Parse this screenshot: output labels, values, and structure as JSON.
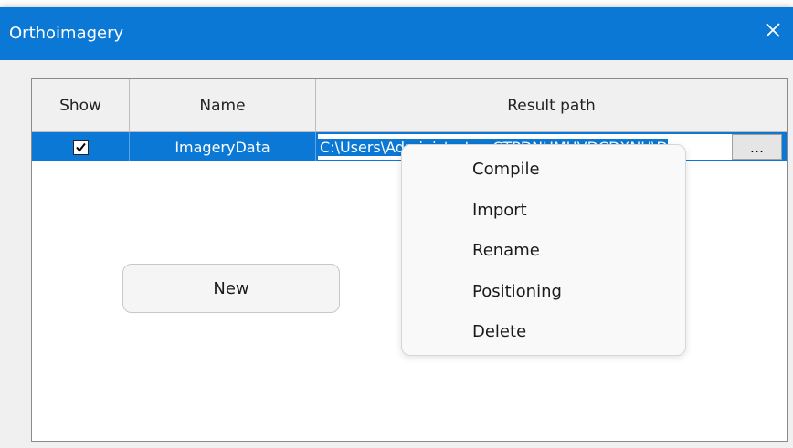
{
  "window": {
    "title": "Orthoimagery"
  },
  "table": {
    "columns": [
      "Show",
      "Name",
      "Result path"
    ],
    "rows": [
      {
        "show_checked": true,
        "name": "ImageryData",
        "path": "C:\\Users\\Administrator_CTPDNUMHVDCDXNU\\D",
        "browse_label": "..."
      }
    ]
  },
  "buttons": {
    "new_label": "New"
  },
  "context_menu": {
    "items": [
      "Compile",
      "Import",
      "Rename",
      "Positioning",
      "Delete"
    ]
  },
  "colors": {
    "titlebar": "#0a78d4",
    "selection": "#0a78d4"
  }
}
